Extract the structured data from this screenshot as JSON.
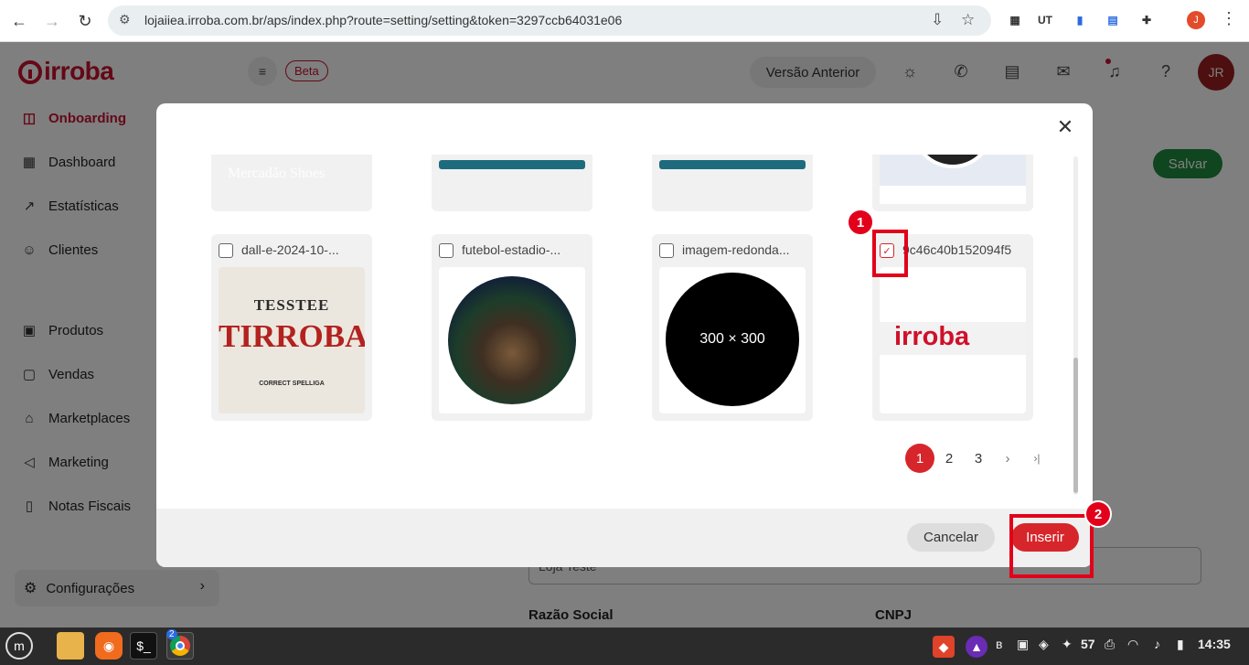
{
  "browser": {
    "url": "lojaiiea.irroba.com.br/aps/index.php?route=setting/setting&token=3297ccb64031e06",
    "profile_initial": "J",
    "ext_ut": "UT"
  },
  "header": {
    "beta_label": "Beta",
    "prev_version_label": "Versão Anterior",
    "avatar_initials": "JR",
    "save_label": "Salvar"
  },
  "logo_text": "irroba",
  "sidebar": {
    "items": [
      {
        "label": "Onboarding",
        "icon": "layout-icon"
      },
      {
        "label": "Dashboard",
        "icon": "grid-icon"
      },
      {
        "label": "Estatísticas",
        "icon": "chart-icon"
      },
      {
        "label": "Clientes",
        "icon": "users-icon"
      },
      {
        "label": "Produtos",
        "icon": "box-icon"
      },
      {
        "label": "Vendas",
        "icon": "bag-icon"
      },
      {
        "label": "Marketplaces",
        "icon": "store-icon"
      },
      {
        "label": "Marketing",
        "icon": "megaphone-icon"
      },
      {
        "label": "Notas Fiscais",
        "icon": "file-icon"
      }
    ],
    "config_label": "Configurações"
  },
  "background_form": {
    "store_name_value": "Loja Teste",
    "razao_label": "Razão Social",
    "cnpj_label": "CNPJ"
  },
  "modal": {
    "cards": [
      {
        "name": "dall-e-2024-10-...",
        "checked": false
      },
      {
        "name": "futebol-estadio-...",
        "checked": false
      },
      {
        "name": "imagem-redonda...",
        "checked": false,
        "placeholder_text": "300 × 300"
      },
      {
        "name": "9c46c40b152094f5",
        "checked": true
      }
    ],
    "thumb_texts": {
      "tesstee_top": "TESSTEE",
      "tesstee_main": "TIRROBA",
      "tesstee_bottom": "CORRECT SPELLIGA",
      "irroba_logo": "irroba",
      "mercadao": "Mercadão Shoes"
    },
    "pagination": [
      "1",
      "2",
      "3",
      "›",
      "›|"
    ],
    "cancel_label": "Cancelar",
    "insert_label": "Inserir"
  },
  "annotations": {
    "marker_1": "1",
    "marker_2": "2"
  },
  "taskbar": {
    "badge_count": "2",
    "tray_number": "57",
    "clock": "14:35"
  },
  "colors": {
    "brand": "#c8102e",
    "accent": "#d7262b",
    "success": "#1e8a3e",
    "annotation": "#e2001a"
  }
}
